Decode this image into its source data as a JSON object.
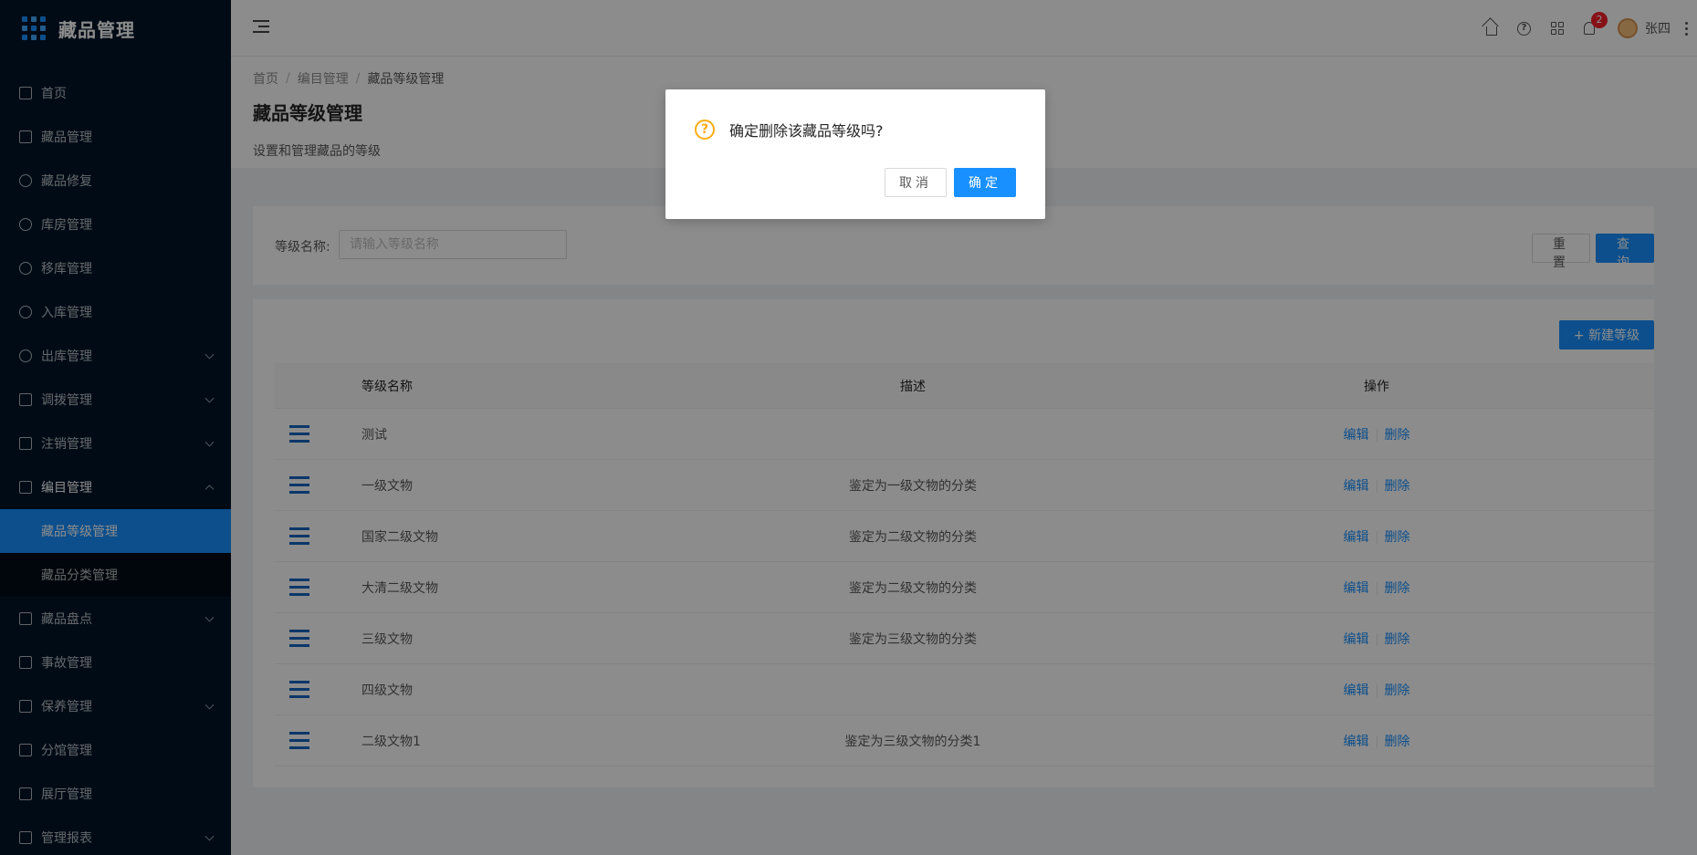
{
  "app": {
    "title": "藏品管理"
  },
  "sidebar": {
    "items": [
      {
        "label": "首页"
      },
      {
        "label": "藏品管理"
      },
      {
        "label": "藏品修复"
      },
      {
        "label": "库房管理"
      },
      {
        "label": "移库管理"
      },
      {
        "label": "入库管理"
      },
      {
        "label": "出库管理"
      },
      {
        "label": "调拨管理"
      },
      {
        "label": "注销管理"
      },
      {
        "label": "编目管理"
      },
      {
        "label": "藏品盘点"
      },
      {
        "label": "事故管理"
      },
      {
        "label": "保养管理"
      },
      {
        "label": "分馆管理"
      },
      {
        "label": "展厅管理"
      },
      {
        "label": "管理报表"
      }
    ],
    "submenu": [
      {
        "label": "藏品等级管理",
        "active": true
      },
      {
        "label": "藏品分类管理",
        "active": false
      }
    ]
  },
  "header": {
    "notification_count": "2",
    "username": "张四"
  },
  "breadcrumb": [
    "首页",
    "编目管理",
    "藏品等级管理"
  ],
  "page": {
    "title": "藏品等级管理",
    "description": "设置和管理藏品的等级"
  },
  "search": {
    "label": "等级名称:",
    "placeholder": "请输入等级名称",
    "value": "",
    "reset_label": "重置",
    "query_label": "查询"
  },
  "table": {
    "new_button": "+ 新建等级",
    "columns": [
      "等级名称",
      "描述",
      "操作"
    ],
    "edit_label": "编辑",
    "delete_label": "删除",
    "rows": [
      {
        "name": "测试",
        "desc": ""
      },
      {
        "name": "一级文物",
        "desc": "鉴定为一级文物的分类"
      },
      {
        "name": "国家二级文物",
        "desc": "鉴定为二级文物的分类"
      },
      {
        "name": "大清二级文物",
        "desc": "鉴定为二级文物的分类"
      },
      {
        "name": "三级文物",
        "desc": "鉴定为三级文物的分类"
      },
      {
        "name": "四级文物",
        "desc": ""
      },
      {
        "name": "二级文物1",
        "desc": "鉴定为三级文物的分类1"
      }
    ]
  },
  "modal": {
    "title": "确定删除该藏品等级吗?",
    "cancel_label": "取消",
    "ok_label": "确定"
  },
  "colors": {
    "primary": "#1890ff",
    "sidebar_bg": "#001529",
    "warning": "#faad14",
    "badge": "#f5222d"
  }
}
